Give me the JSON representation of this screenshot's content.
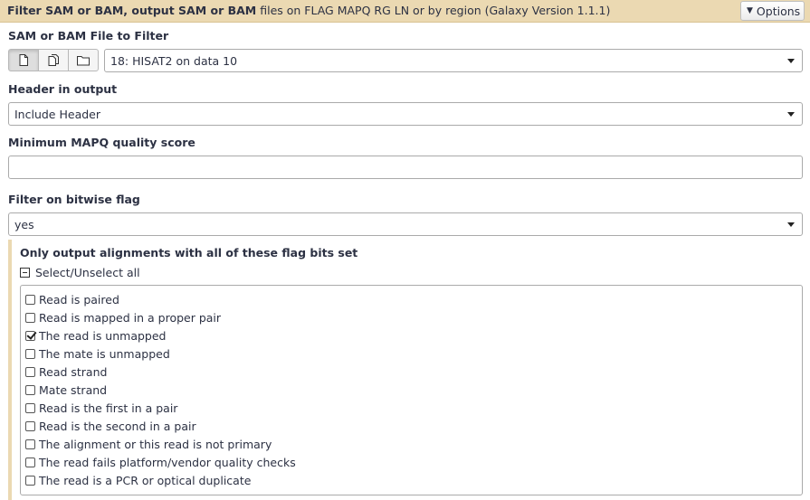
{
  "header": {
    "title_bold": "Filter SAM or BAM, output SAM or BAM",
    "title_rest": " files on FLAG MAPQ RG LN or by region (Galaxy Version 1.1.1)",
    "options_label": "Options"
  },
  "input_file": {
    "label": "SAM or BAM File to Filter",
    "value": "18: HISAT2 on data 10",
    "mode_icons": [
      "single-file-icon",
      "multiple-files-icon",
      "collection-folder-icon"
    ]
  },
  "header_output": {
    "label": "Header in output",
    "value": "Include Header"
  },
  "mapq": {
    "label": "Minimum MAPQ quality score",
    "value": ""
  },
  "bitwise": {
    "label": "Filter on bitwise flag",
    "value": "yes"
  },
  "flags_section": {
    "label": "Only output alignments with all of these flag bits set",
    "select_all_label": "Select/Unselect all",
    "options": [
      {
        "label": "Read is paired",
        "checked": false
      },
      {
        "label": "Read is mapped in a proper pair",
        "checked": false
      },
      {
        "label": "The read is unmapped",
        "checked": true
      },
      {
        "label": "The mate is unmapped",
        "checked": false
      },
      {
        "label": "Read strand",
        "checked": false
      },
      {
        "label": "Mate strand",
        "checked": false
      },
      {
        "label": "Read is the first in a pair",
        "checked": false
      },
      {
        "label": "Read is the second in a pair",
        "checked": false
      },
      {
        "label": "The alignment or this read is not primary",
        "checked": false
      },
      {
        "label": "The read fails platform/vendor quality checks",
        "checked": false
      },
      {
        "label": "The read is a PCR or optical duplicate",
        "checked": false
      }
    ]
  },
  "colors": {
    "header_bg": "#ebd9b2",
    "text": "#2c3143",
    "border": "#aaaaaa"
  }
}
